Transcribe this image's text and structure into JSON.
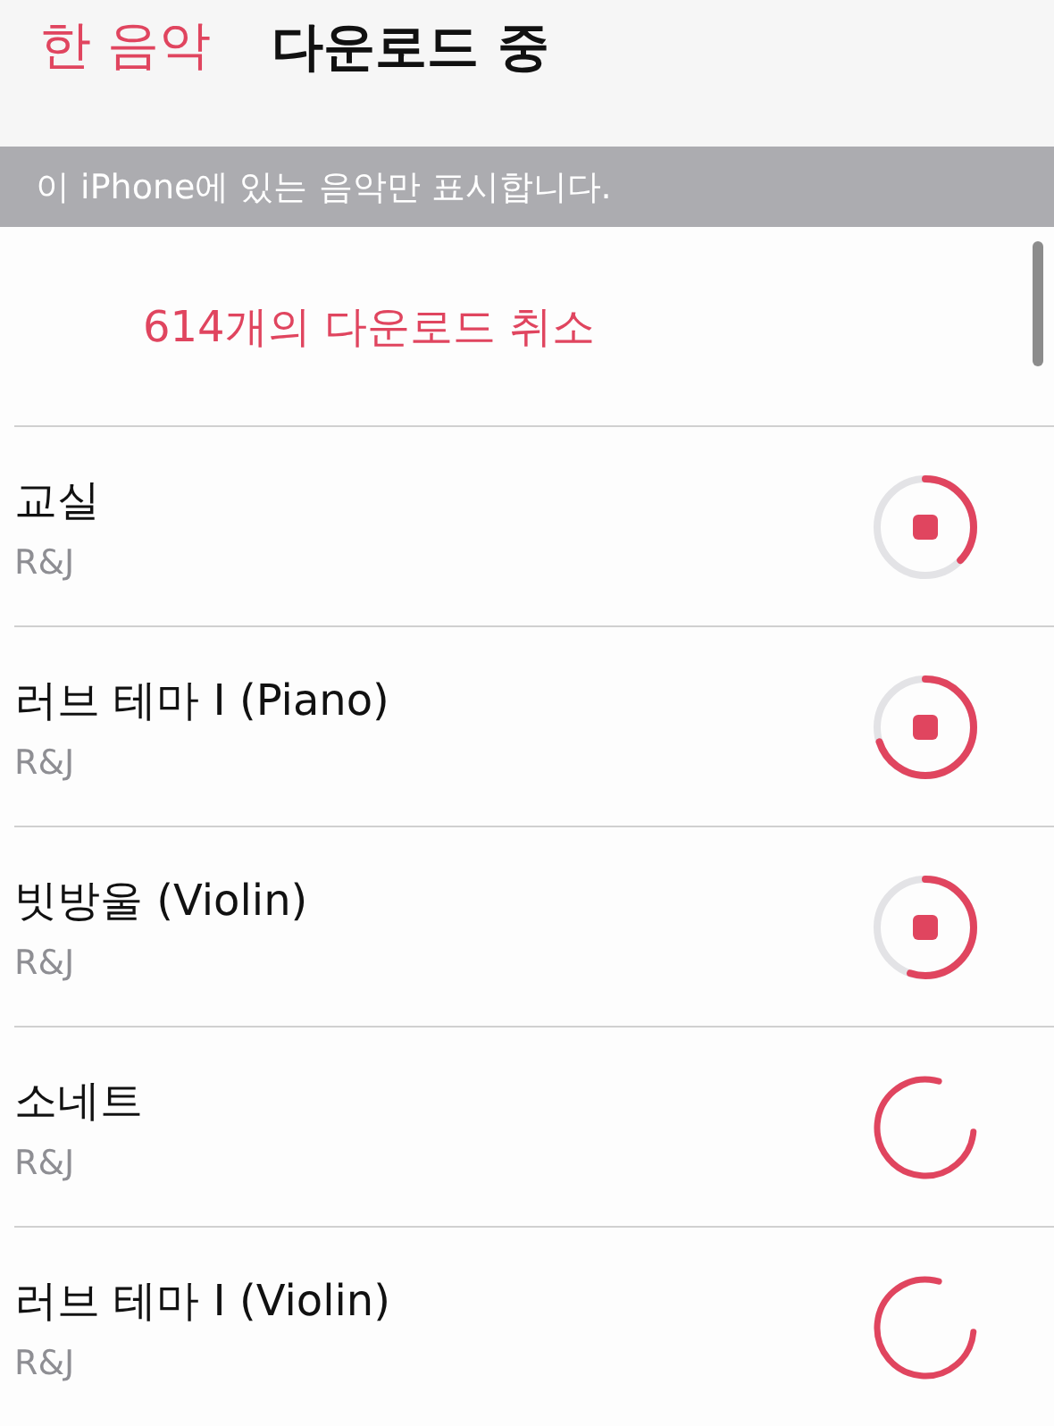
{
  "nav": {
    "back_label": "한 음악",
    "title": "다운로드 중"
  },
  "banner": "이 iPhone에 있는 음악만 표시합니다.",
  "cancel_button": "614개의 다운로드 취소",
  "downloads": [
    {
      "kind": "downloading",
      "title": "교실",
      "artist": "R&J",
      "level": 0.37
    },
    {
      "kind": "downloading",
      "title": "러브 테마 I (Piano)",
      "artist": "R&J",
      "level": 0.7
    },
    {
      "kind": "downloading",
      "title": "빗방울 (Violin)",
      "artist": "R&J",
      "level": 0.55
    },
    {
      "kind": "waiting",
      "title": "소네트",
      "artist": "R&J"
    },
    {
      "kind": "waiting",
      "title": "러브 테마 I (Violin)",
      "artist": "R&J"
    }
  ]
}
